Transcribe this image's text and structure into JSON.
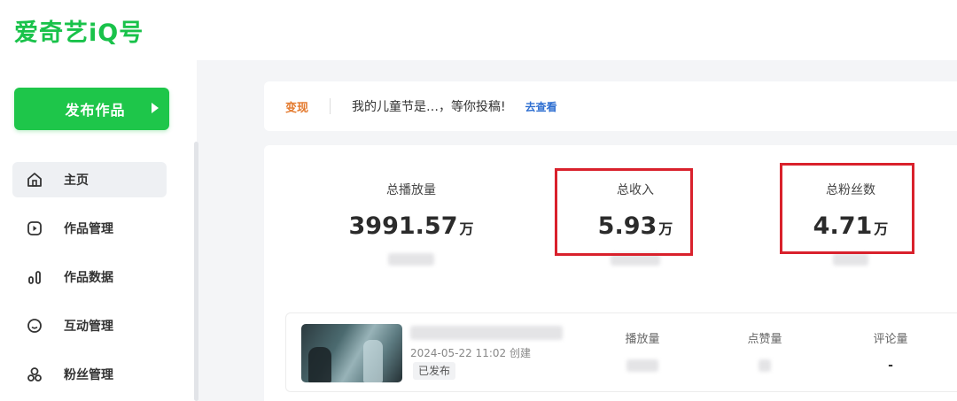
{
  "brand": {
    "logo_text": "爱奇艺iQ号",
    "accent": "#1ec64a"
  },
  "sidebar": {
    "publish_label": "发布作品",
    "items": [
      {
        "label": "主页",
        "icon": "home-icon",
        "active": true
      },
      {
        "label": "作品管理",
        "icon": "play-square-icon",
        "active": false
      },
      {
        "label": "作品数据",
        "icon": "bar-chart-icon",
        "active": false
      },
      {
        "label": "互动管理",
        "icon": "chat-bubble-icon",
        "active": false
      },
      {
        "label": "粉丝管理",
        "icon": "users-icon",
        "active": false
      }
    ]
  },
  "notice": {
    "tag": "变现",
    "text": "我的儿童节是…，等你投稿!",
    "link": "去查看",
    "tag_color": "#e3782b"
  },
  "stats": [
    {
      "label": "总播放量",
      "value": "3991.57",
      "unit": "万",
      "highlighted": false
    },
    {
      "label": "总收入",
      "value": "5.93",
      "unit": "万",
      "highlighted": true
    },
    {
      "label": "总粉丝数",
      "value": "4.71",
      "unit": "万",
      "highlighted": true
    }
  ],
  "highlight_color": "#d9212c",
  "content": {
    "created": "2024-05-22 11:02 创建",
    "status": "已发布",
    "metrics": [
      {
        "label": "播放量",
        "value": ""
      },
      {
        "label": "点赞量",
        "value": ""
      },
      {
        "label": "评论量",
        "value": "-"
      }
    ]
  }
}
